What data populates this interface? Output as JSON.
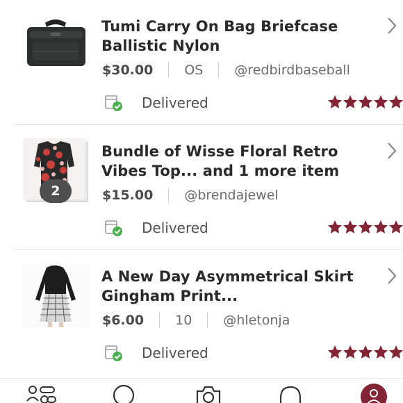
{
  "orders": [
    {
      "title": "Tumi Carry On Bag Briefcase Ballistic Nylon",
      "price": "$30.00",
      "size": "OS",
      "seller": "@redbirdbaseball",
      "status": "Delivered",
      "rating": 5,
      "thumb_icon": "briefcase-photo"
    },
    {
      "title": "Bundle of Wisse Floral Retro Vibes Top... and 1 more item",
      "price": "$15.00",
      "seller": "@brendajewel",
      "status": "Delivered",
      "rating": 5,
      "bundle_count": "2",
      "thumb_icon": "floral-top-photo"
    },
    {
      "title": "A New Day Asymmetrical Skirt Gingham Print...",
      "price": "$6.00",
      "size": "10",
      "seller": "@hletonja",
      "status": "Delivered",
      "rating": 5,
      "thumb_icon": "skirt-photo"
    }
  ],
  "colors": {
    "accent": "#822433",
    "star": "#822433",
    "delivered_check": "#4caf50"
  },
  "tabbar": {
    "items": [
      "feed-icon",
      "search-icon",
      "camera-icon",
      "notifications-icon",
      "profile-icon"
    ]
  }
}
